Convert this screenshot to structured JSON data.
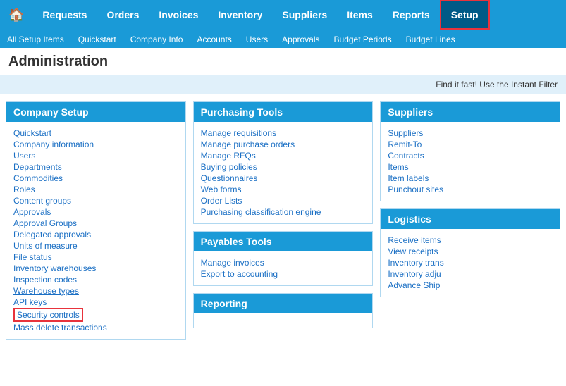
{
  "topNav": {
    "home_icon": "🏠",
    "items": [
      {
        "label": "Requests",
        "active": false
      },
      {
        "label": "Orders",
        "active": false
      },
      {
        "label": "Invoices",
        "active": false
      },
      {
        "label": "Inventory",
        "active": false
      },
      {
        "label": "Suppliers",
        "active": false
      },
      {
        "label": "Items",
        "active": false
      },
      {
        "label": "Reports",
        "active": false
      },
      {
        "label": "Setup",
        "active": true
      }
    ]
  },
  "subNav": {
    "items": [
      {
        "label": "All Setup Items"
      },
      {
        "label": "Quickstart"
      },
      {
        "label": "Company Info"
      },
      {
        "label": "Accounts"
      },
      {
        "label": "Users"
      },
      {
        "label": "Approvals"
      },
      {
        "label": "Budget Periods"
      },
      {
        "label": "Budget Lines"
      }
    ]
  },
  "pageTitle": "Administration",
  "filterBar": "Find it fast! Use the Instant Filter",
  "columns": [
    {
      "sections": [
        {
          "header": "Company Setup",
          "links": [
            {
              "label": "Quickstart",
              "underlined": false,
              "highlighted": false
            },
            {
              "label": "Company information",
              "underlined": false,
              "highlighted": false
            },
            {
              "label": "Users",
              "underlined": false,
              "highlighted": false
            },
            {
              "label": "Departments",
              "underlined": false,
              "highlighted": false
            },
            {
              "label": "Commodities",
              "underlined": false,
              "highlighted": false
            },
            {
              "label": "Roles",
              "underlined": false,
              "highlighted": false
            },
            {
              "label": "Content groups",
              "underlined": false,
              "highlighted": false
            },
            {
              "label": "Approvals",
              "underlined": false,
              "highlighted": false
            },
            {
              "label": "Approval Groups",
              "underlined": false,
              "highlighted": false
            },
            {
              "label": "Delegated approvals",
              "underlined": false,
              "highlighted": false
            },
            {
              "label": "Units of measure",
              "underlined": false,
              "highlighted": false
            },
            {
              "label": "File status",
              "underlined": false,
              "highlighted": false
            },
            {
              "label": "Inventory warehouses",
              "underlined": false,
              "highlighted": false
            },
            {
              "label": "Inspection codes",
              "underlined": false,
              "highlighted": false
            },
            {
              "label": "Warehouse types",
              "underlined": true,
              "highlighted": false
            },
            {
              "label": "API keys",
              "underlined": false,
              "highlighted": false
            },
            {
              "label": "Security controls",
              "underlined": false,
              "highlighted": true
            },
            {
              "label": "Mass delete transactions",
              "underlined": false,
              "highlighted": false
            }
          ]
        }
      ]
    },
    {
      "sections": [
        {
          "header": "Purchasing Tools",
          "links": [
            {
              "label": "Manage requisitions"
            },
            {
              "label": "Manage purchase orders"
            },
            {
              "label": "Manage RFQs"
            },
            {
              "label": "Buying policies"
            },
            {
              "label": "Questionnaires"
            },
            {
              "label": "Web forms"
            },
            {
              "label": "Order Lists"
            },
            {
              "label": "Purchasing classification engine"
            }
          ]
        },
        {
          "header": "Payables Tools",
          "links": [
            {
              "label": "Manage invoices"
            },
            {
              "label": "Export to accounting"
            }
          ]
        },
        {
          "header": "Reporting",
          "links": []
        }
      ]
    },
    {
      "sections": [
        {
          "header": "Suppliers",
          "links": [
            {
              "label": "Suppliers"
            },
            {
              "label": "Remit-To"
            },
            {
              "label": "Contracts"
            },
            {
              "label": "Items"
            },
            {
              "label": "Item labels"
            },
            {
              "label": "Punchout sites"
            }
          ]
        },
        {
          "header": "Logistics",
          "links": [
            {
              "label": "Receive items"
            },
            {
              "label": "View receipts"
            },
            {
              "label": "Inventory trans"
            },
            {
              "label": "Inventory adju"
            },
            {
              "label": "Advance Ship"
            }
          ]
        }
      ]
    }
  ]
}
